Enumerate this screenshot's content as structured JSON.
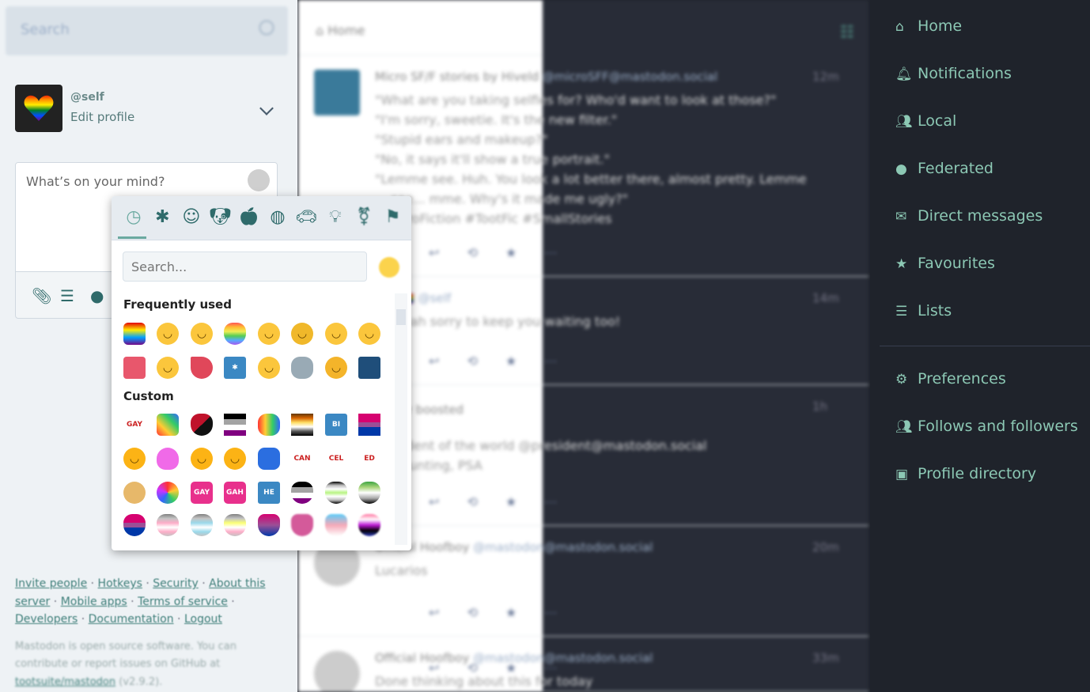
{
  "search": {
    "placeholder": "Search",
    "icon": "search-icon"
  },
  "profile": {
    "handle": "@self",
    "edit": "Edit profile"
  },
  "compose": {
    "placeholder": "What’s on your mind?",
    "icons": [
      "paperclip-icon",
      "poll-icon",
      "globe-icon"
    ]
  },
  "footer": {
    "links": [
      "Invite people",
      "Hotkeys",
      "Security",
      "About this server",
      "Mobile apps",
      "Terms of service",
      "Developers",
      "Documentation",
      "Logout"
    ],
    "about_pre": "Mastodon is open source software. You can contribute or report issues on GitHub at ",
    "repo": "tootsuite/mastodon",
    "version": " (v2.9.2)."
  },
  "column": {
    "title": "Home"
  },
  "posts": [
    {
      "name": "Micro SF/F stories by Hiveld",
      "handle": "@microSFF@mastodon.social",
      "time": "12m",
      "text": "\"What are you taking selfies for? Who'd want to look at those?\"\n\"I'm sorry, sweetie. It's the new filter.\"\n\"Stupid ears and makeup?\"\n\"No, it says it'll show a true portrait.\"\n\"Lemme see. Huh. You look a lot better there, almost pretty. Lemme\n    see... mme. Why's it made me ugly?\"\n#MicroFiction #TootFic #SmallStories"
    },
    {
      "name": "self 🏳️‍🌈",
      "handle": "@self",
      "time": "14m",
      "text": "@supah sorry to keep you waiting too!"
    },
    {
      "name": "bunny boosted",
      "handle": "",
      "time": "1h",
      "text": "president of the world @president@mastodon.social\nalc, hunting, PSA"
    },
    {
      "name": "Official Hoofboy",
      "handle": "@mastodon@mastodon.social",
      "time": "20m",
      "text": "Lucarios"
    },
    {
      "name": "Official Hoofboy",
      "handle": "@mastodon@mastodon.social",
      "time": "33m",
      "text": "Done thinking about this for today"
    }
  ],
  "nav": {
    "items": [
      {
        "label": "Home",
        "icon": "home-icon",
        "glyph": "⌂"
      },
      {
        "label": "Notifications",
        "icon": "bell-icon",
        "glyph": "🔔︎"
      },
      {
        "label": "Local",
        "icon": "users-icon",
        "glyph": "👥︎"
      },
      {
        "label": "Federated",
        "icon": "globe-icon",
        "glyph": "●"
      },
      {
        "label": "Direct messages",
        "icon": "envelope-icon",
        "glyph": "✉"
      },
      {
        "label": "Favourites",
        "icon": "star-icon",
        "glyph": "★"
      },
      {
        "label": "Lists",
        "icon": "list-icon",
        "glyph": "☰"
      }
    ],
    "items2": [
      {
        "label": "Preferences",
        "icon": "gear-icon",
        "glyph": "⚙"
      },
      {
        "label": "Follows and followers",
        "icon": "users-icon",
        "glyph": "👥︎"
      },
      {
        "label": "Profile directory",
        "icon": "address-book-icon",
        "glyph": "▣"
      }
    ],
    "color": "#8cc8b4"
  },
  "picker": {
    "tabs": [
      {
        "icon": "clock-icon",
        "glyph": "◷"
      },
      {
        "icon": "asterisk-icon",
        "glyph": "✱"
      },
      {
        "icon": "smiley-icon",
        "glyph": "☺"
      },
      {
        "icon": "dog-icon",
        "glyph": "🐶︎"
      },
      {
        "icon": "apple-icon",
        "glyph": "🍎︎"
      },
      {
        "icon": "basketball-icon",
        "glyph": "◍"
      },
      {
        "icon": "car-icon",
        "glyph": "🚗︎"
      },
      {
        "icon": "lightbulb-icon",
        "glyph": "💡︎"
      },
      {
        "icon": "symbols-icon",
        "glyph": "⚧"
      },
      {
        "icon": "flag-icon",
        "glyph": "⚑"
      }
    ],
    "search_placeholder": "Search...",
    "frequent_label": "Frequently used",
    "custom_label": "Custom",
    "frequent": [
      {
        "name": "mastodon",
        "bg": "linear-gradient(#e40303,#ffed00,#00a0ff,#750787)",
        "r": "6px"
      },
      {
        "name": "wink",
        "bg": "#fbc63c"
      },
      {
        "name": "blush",
        "bg": "#fbc63c"
      },
      {
        "name": "rainbow-heart",
        "bg": "linear-gradient(#f55,#fb3,#ee5,#5c5,#5af,#a5e)",
        "r": "40% 40% 50% 50%"
      },
      {
        "name": "sweat-smile",
        "bg": "#fbc63c"
      },
      {
        "name": "rofl",
        "bg": "#f0b82a"
      },
      {
        "name": "stuck-out-tongue-winking",
        "bg": "#fbc63c"
      },
      {
        "name": "slight-smile",
        "bg": "#fbc63c"
      },
      {
        "name": "white-heart-square",
        "bg": "#e8576c",
        "r": "4px"
      },
      {
        "name": "grin",
        "bg": "#fbc63c"
      },
      {
        "name": "tada",
        "bg": "#e0475a",
        "r": "2px 50% 50% 50%"
      },
      {
        "name": "asterisk-square",
        "bg": "#3b88c3",
        "r": "3px",
        "t": "✱"
      },
      {
        "name": "joy",
        "bg": "#fbc63c"
      },
      {
        "name": "elephant",
        "bg": "#99aab5",
        "r": "40%"
      },
      {
        "name": "thinking",
        "bg": "#f4b42a"
      },
      {
        "name": "sparkler",
        "bg": "#1f4e7a",
        "r": "3px"
      }
    ],
    "custom": [
      {
        "name": "gay-text",
        "bg": "transparent",
        "c": "#c22",
        "t": "GAY"
      },
      {
        "name": "sparkles-rainbow",
        "bg": "linear-gradient(45deg,#f33,#fc3,#3c6,#36f)",
        "r": "20%"
      },
      {
        "name": "black-red-heart",
        "bg": "linear-gradient(135deg,#c0122b 50%,#111 50%)",
        "r": "40% 40% 50% 50%"
      },
      {
        "name": "ace-flag",
        "bg": "linear-gradient(#000 25%,#a3a3a3 25% 50%,#fff 50% 75%,#800080 75%)",
        "r": "0"
      },
      {
        "name": "infinity-rainbow",
        "bg": "linear-gradient(90deg,#f33,#fc3,#3c6,#36f)",
        "r": "40%"
      },
      {
        "name": "bear-flag",
        "bg": "linear-gradient(#623804,#d56300,#fedd63,#fff,#555,#000)",
        "r": "0"
      },
      {
        "name": "bi-square",
        "bg": "#3b88c3",
        "r": "3px",
        "t": "BI"
      },
      {
        "name": "bi-flag",
        "bg": "linear-gradient(#d60270 40%,#9b4f96 40% 60%,#0038a8 60%)",
        "r": "0"
      },
      {
        "name": "blob-heart-eyes",
        "bg": "#fcb315"
      },
      {
        "name": "blob-pink",
        "bg": "#f06ae8",
        "r": "50% 50% 40% 40%"
      },
      {
        "name": "blob-laugh",
        "bg": "#fcb315"
      },
      {
        "name": "blob-think",
        "bg": "#fcb315"
      },
      {
        "name": "butterfly",
        "bg": "#2b6ee0",
        "r": "30%"
      },
      {
        "name": "cancelled-1",
        "bg": "#fff",
        "c": "#c22",
        "t": "CAN",
        "r": "0"
      },
      {
        "name": "cancelled-2",
        "bg": "#fff",
        "c": "#c22",
        "t": "CEL",
        "r": "0"
      },
      {
        "name": "cancelled-3",
        "bg": "#fff",
        "c": "#c22",
        "t": "ED",
        "r": "0"
      },
      {
        "name": "doge",
        "bg": "#e7b86a"
      },
      {
        "name": "fediverse",
        "bg": "conic-gradient(#f33,#fc3,#3c6,#36f,#c3f,#f33)"
      },
      {
        "name": "gay-badge",
        "bg": "#e8308c",
        "r": "5px",
        "t": "GAY"
      },
      {
        "name": "gay-as-hell",
        "bg": "#e8308c",
        "r": "5px",
        "t": "GAH"
      },
      {
        "name": "he-him",
        "bg": "#3b88c3",
        "r": "3px",
        "t": "HE"
      },
      {
        "name": "ace-heart",
        "bg": "linear-gradient(#000 25%,#a3a3a3 25% 50%,#fff 50% 75%,#800080 75%)",
        "r": "40% 40% 50% 50%"
      },
      {
        "name": "agender-heart",
        "bg": "linear-gradient(#000,#bbb,#fff,#b8f483,#fff,#bbb,#000)",
        "r": "40% 40% 50% 50%"
      },
      {
        "name": "aro-heart",
        "bg": "linear-gradient(#3da542,#a7d379,#fff,#a9a9a9,#000)",
        "r": "40% 40% 50% 50%"
      },
      {
        "name": "bi-heart",
        "bg": "linear-gradient(#d60270 40%,#9b4f96 40% 60%,#0038a8 60%)",
        "r": "40% 40% 50% 50%"
      },
      {
        "name": "demigirl-heart",
        "bg": "linear-gradient(#7f7f7f,#c4c4c4,#fdadc8,#fff,#fdadc8,#c4c4c4)",
        "r": "40% 40% 50% 50%"
      },
      {
        "name": "demiboy-heart",
        "bg": "linear-gradient(#7f7f7f,#c4c4c4,#9ad9eb,#fff,#9ad9eb,#c4c4c4)",
        "r": "40% 40% 50% 50%"
      },
      {
        "name": "demigender-heart",
        "bg": "linear-gradient(#7f7f7f,#c4c4c4,#fbff75,#fff,#fdadc8,#c4c4c4)",
        "r": "40% 40% 50% 50%"
      },
      {
        "name": "bi-cat",
        "bg": "linear-gradient(#d60270,#9b4f96,#0038a8)",
        "r": "30% 30% 50% 50%"
      },
      {
        "name": "pink-cat",
        "bg": "#d45a9a",
        "r": "30% 30% 50% 50%"
      },
      {
        "name": "trans-cat",
        "bg": "linear-gradient(#5bcefa,#f5a9b8,#fff)",
        "r": "30% 30% 50% 50%"
      },
      {
        "name": "genderfluid-heart",
        "bg": "linear-gradient(#ff75a2,#fff,#be18d6,#000,#333ebd)",
        "r": "40% 40% 50% 50%"
      }
    ]
  }
}
